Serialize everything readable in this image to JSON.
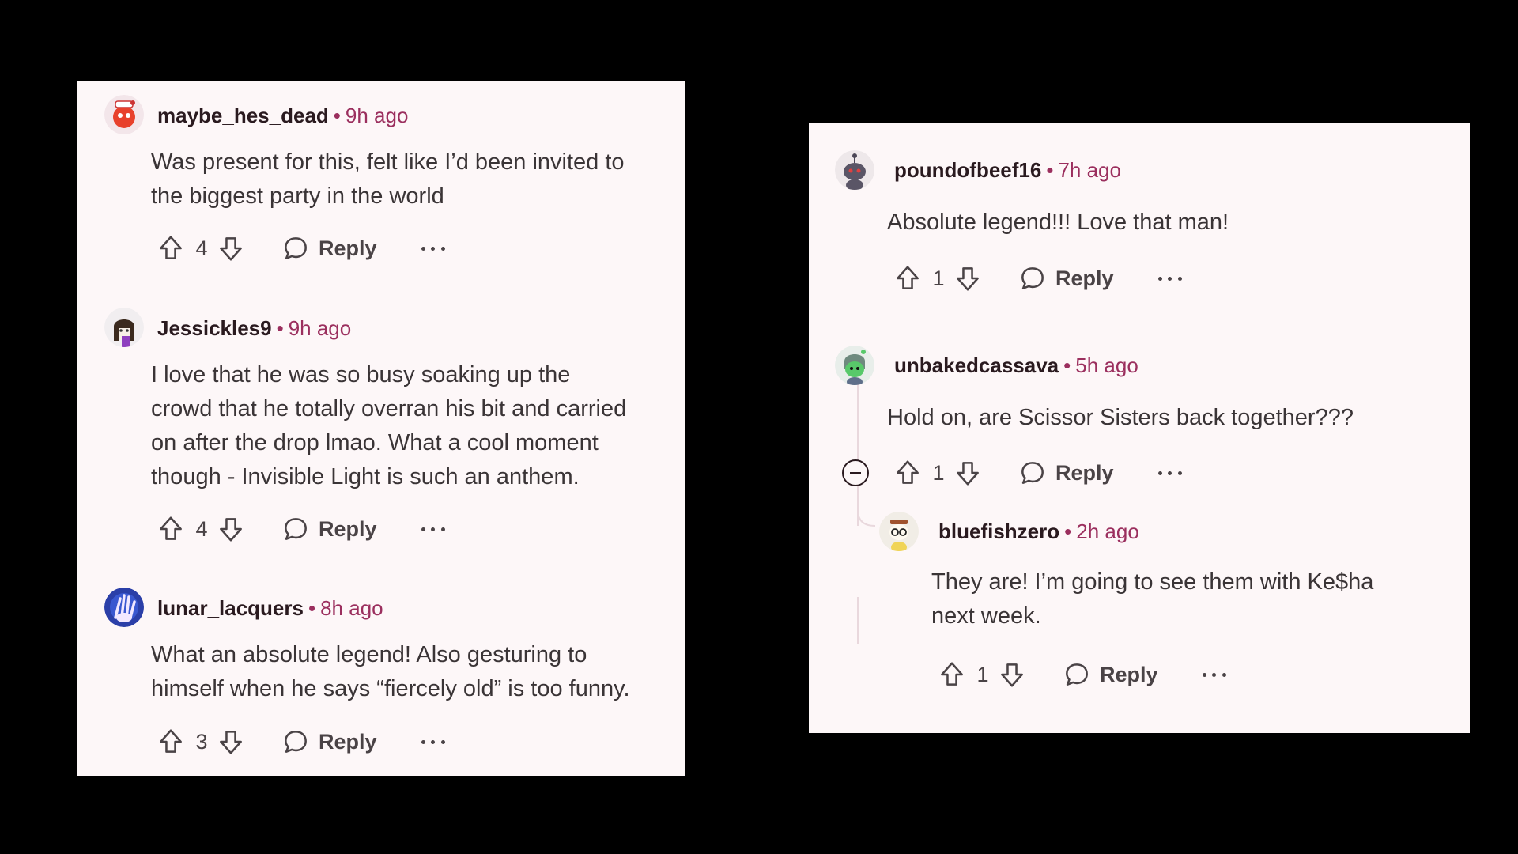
{
  "ui": {
    "reply_label": "Reply",
    "separator": "•"
  },
  "left_comments": [
    {
      "username": "maybe_hes_dead",
      "time": "9h ago",
      "text": "Was present for this, felt like I’d been invited to\nthe biggest party in the world",
      "score": "4"
    },
    {
      "username": "Jessickles9",
      "time": "9h ago",
      "text": "I love that he was so busy soaking up the\ncrowd that he totally overran his bit and carried\non after the drop lmao. What a cool moment\nthough - Invisible Light is such an anthem.",
      "score": "4"
    },
    {
      "username": "lunar_lacquers",
      "time": "8h ago",
      "text": "What an absolute legend! Also gesturing to\nhimself when he says “fiercely old” is too funny.",
      "score": "3"
    }
  ],
  "right_comments": [
    {
      "username": "poundofbeef16",
      "time": "7h ago",
      "text": "Absolute legend!!! Love that man!",
      "score": "1"
    },
    {
      "username": "unbakedcassava",
      "time": "5h ago",
      "text": "Hold on, are Scissor Sisters back together???",
      "score": "1"
    },
    {
      "username": "bluefishzero",
      "time": "2h ago",
      "text": "They are! I’m going to see them with Ke$ha\nnext week.",
      "score": "1"
    }
  ],
  "icons": {
    "upvote": "arrow-up-outline-icon",
    "downvote": "arrow-down-outline-icon",
    "reply": "speech-bubble-icon",
    "more": "ellipsis-icon",
    "collapse": "minus-circle-icon"
  },
  "colors": {
    "background": "#000000",
    "panel": "#fdf7f8",
    "timestamp": "#9b2f5e",
    "username": "#2a1a1f"
  }
}
